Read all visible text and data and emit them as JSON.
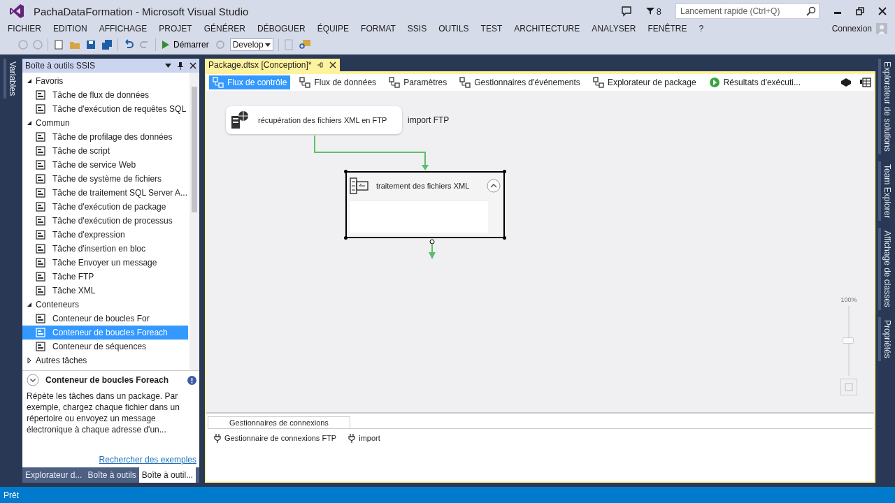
{
  "window": {
    "title": "PachaDataFormation - Microsoft Visual Studio",
    "notification_count": "8",
    "quick_launch": {
      "placeholder": "Lancement rapide (Ctrl+Q)"
    },
    "sign_in": "Connexion"
  },
  "menu": [
    "FICHIER",
    "EDITION",
    "AFFICHAGE",
    "PROJET",
    "GÉNÉRER",
    "DÉBOGUER",
    "ÉQUIPE",
    "FORMAT",
    "SSIS",
    "OUTILS",
    "TEST",
    "ARCHITECTURE",
    "ANALYSER",
    "FENÊTRE",
    "?"
  ],
  "toolbar": {
    "start": "Démarrer",
    "configuration": "Develop"
  },
  "left_strip": [
    "Variables"
  ],
  "toolbox": {
    "title": "Boîte à outils SSIS",
    "groups": [
      {
        "label": "Favoris",
        "expanded": true,
        "items": [
          {
            "label": "Tâche de flux de données",
            "selected": false
          },
          {
            "label": "Tâche d'exécution de requêtes SQL",
            "selected": false
          }
        ]
      },
      {
        "label": "Commun",
        "expanded": true,
        "items": [
          {
            "label": "Tâche de profilage des données",
            "selected": false
          },
          {
            "label": "Tâche de script",
            "selected": false
          },
          {
            "label": "Tâche de service Web",
            "selected": false
          },
          {
            "label": "Tâche de système de fichiers",
            "selected": false
          },
          {
            "label": "Tâche de traitement SQL Server A...",
            "selected": false
          },
          {
            "label": "Tâche d'exécution de package",
            "selected": false
          },
          {
            "label": "Tâche d'exécution de processus",
            "selected": false
          },
          {
            "label": "Tâche d'expression",
            "selected": false
          },
          {
            "label": "Tâche d'insertion en bloc",
            "selected": false
          },
          {
            "label": "Tâche Envoyer un message",
            "selected": false
          },
          {
            "label": "Tâche FTP",
            "selected": false
          },
          {
            "label": "Tâche XML",
            "selected": false
          }
        ]
      },
      {
        "label": "Conteneurs",
        "expanded": true,
        "items": [
          {
            "label": "Conteneur de boucles For",
            "selected": false
          },
          {
            "label": "Conteneur de boucles Foreach",
            "selected": true
          },
          {
            "label": "Conteneur de séquences",
            "selected": false
          }
        ]
      },
      {
        "label": "Autres tâches",
        "expanded": false
      }
    ],
    "description": {
      "title": "Conteneur de boucles Foreach",
      "text": "Répète les tâches dans un package. Par exemple, chargez chaque fichier dans un répertoire ou envoyez un message électronique à chaque adresse d'un...",
      "link": "Rechercher des exemples"
    },
    "tabs": [
      {
        "label": "Explorateur d...",
        "selected": false
      },
      {
        "label": "Boîte à outils",
        "selected": false
      },
      {
        "label": "Boîte à outil...",
        "selected": true
      }
    ]
  },
  "document_tab": {
    "label": "Package.dtsx [Conception]*"
  },
  "designer_tabs": [
    {
      "label": "Flux de contrôle",
      "selected": true
    },
    {
      "label": "Flux de données",
      "selected": false
    },
    {
      "label": "Paramètres",
      "selected": false
    },
    {
      "label": "Gestionnaires d'événements",
      "selected": false
    },
    {
      "label": "Explorateur de package",
      "selected": false
    },
    {
      "label": "Résultats d'exécuti...",
      "selected": false
    }
  ],
  "canvas": {
    "nodes": [
      {
        "kind": "task",
        "label": "récupération des fichiers XML en FTP",
        "annotation": "import FTP"
      },
      {
        "kind": "container",
        "label": "traitement des fichiers XML"
      }
    ]
  },
  "zoom": {
    "label": "100%",
    "level": 0.5
  },
  "connections": {
    "title": "Gestionnaires de connexions",
    "items": [
      "Gestionnaire de connexions FTP",
      "import"
    ]
  },
  "right_strip": [
    "Explorateur de solutions",
    "Team Explorer",
    "Affichage de classes",
    "Propriétés"
  ],
  "status_bar": "Prêt"
}
